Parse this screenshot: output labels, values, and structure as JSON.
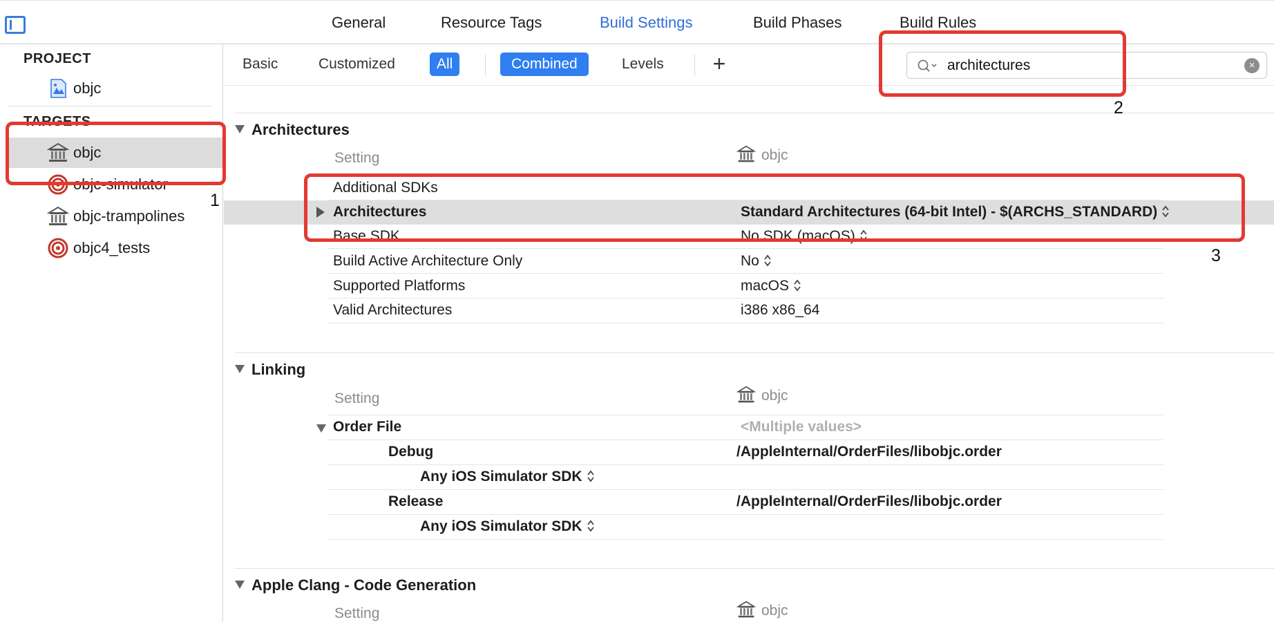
{
  "tabs": [
    "General",
    "Resource Tags",
    "Build Settings",
    "Build Phases",
    "Build Rules"
  ],
  "active_tab": "Build Settings",
  "sidebar": {
    "project_header": "PROJECT",
    "project": {
      "label": "objc",
      "icon": "blueprint-icon"
    },
    "targets_header": "TARGETS",
    "targets": [
      {
        "label": "objc",
        "icon": "library-icon",
        "selected": true
      },
      {
        "label": "objc-simulator",
        "icon": "target-icon",
        "selected": false
      },
      {
        "label": "objc-trampolines",
        "icon": "library-icon",
        "selected": false
      },
      {
        "label": "objc4_tests",
        "icon": "target-icon",
        "selected": false
      }
    ]
  },
  "filters": {
    "basic": "Basic",
    "customized": "Customized",
    "all": "All",
    "combined": "Combined",
    "levels": "Levels",
    "add": "+"
  },
  "search": {
    "value": "architectures"
  },
  "sections": {
    "architectures": {
      "title": "Architectures",
      "col_setting": "Setting",
      "col_target": "objc",
      "rows": [
        {
          "name": "Additional SDKs",
          "value": ""
        },
        {
          "name": "Architectures",
          "value": "Standard Architectures (64-bit Intel)  -  $(ARCHS_STANDARD)"
        },
        {
          "name": "Base SDK",
          "value": "No SDK (macOS)"
        },
        {
          "name": "Build Active Architecture Only",
          "value": "No"
        },
        {
          "name": "Supported Platforms",
          "value": "macOS"
        },
        {
          "name": "Valid Architectures",
          "value": "i386 x86_64"
        }
      ]
    },
    "linking": {
      "title": "Linking",
      "col_setting": "Setting",
      "col_target": "objc",
      "order_file": {
        "name": "Order File",
        "value": "<Multiple values>"
      },
      "debug": {
        "name": "Debug",
        "value": "/AppleInternal/OrderFiles/libobjc.order"
      },
      "debug_sdk": "Any iOS Simulator SDK",
      "release": {
        "name": "Release",
        "value": "/AppleInternal/OrderFiles/libobjc.order"
      },
      "release_sdk": "Any iOS Simulator SDK"
    },
    "clang": {
      "title": "Apple Clang - Code Generation",
      "col_setting": "Setting",
      "col_target": "objc"
    }
  },
  "annotations": {
    "one": "1",
    "two": "2",
    "three": "3"
  },
  "colors": {
    "accent": "#2f7ff0",
    "annotation_red": "#e23a32"
  }
}
